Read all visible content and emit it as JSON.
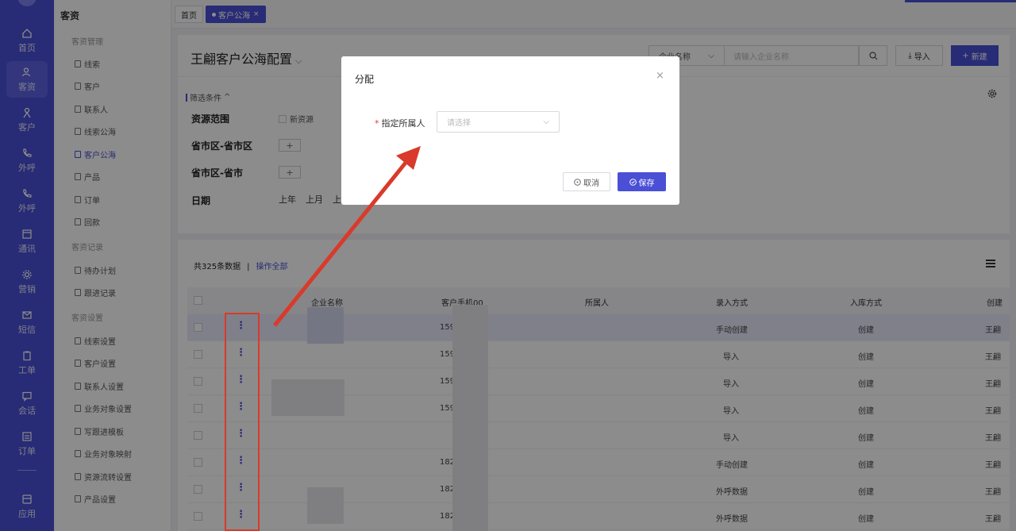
{
  "rail": {
    "items": [
      {
        "label": "首页",
        "icon": "home-icon"
      },
      {
        "label": "客资",
        "icon": "users-icon"
      },
      {
        "label": "客户",
        "icon": "person-icon"
      },
      {
        "label": "外呼",
        "icon": "phone-out-icon"
      },
      {
        "label": "外呼",
        "icon": "phone-call-icon"
      },
      {
        "label": "通讯",
        "icon": "contacts-icon"
      },
      {
        "label": "营销",
        "icon": "gear-icon"
      },
      {
        "label": "短信",
        "icon": "message-icon"
      },
      {
        "label": "工单",
        "icon": "clipboard-icon"
      },
      {
        "label": "会话",
        "icon": "chat-icon"
      },
      {
        "label": "订单",
        "icon": "order-icon"
      },
      {
        "label": "应用",
        "icon": "apps-icon"
      }
    ]
  },
  "menu": {
    "title": "客资",
    "groups": [
      {
        "label": "客资管理",
        "items": [
          "线索",
          "客户",
          "联系人",
          "线索公海",
          "客户公海",
          "产品",
          "订单",
          "回款"
        ]
      },
      {
        "label": "客资记录",
        "items": [
          "待办计划",
          "跟进记录"
        ]
      },
      {
        "label": "客资设置",
        "items": [
          "线索设置",
          "客户设置",
          "联系人设置",
          "业务对象设置",
          "写跟进模板",
          "业务对象映射",
          "资源流转设置",
          "产品设置"
        ]
      }
    ]
  },
  "tabs": [
    {
      "label": "首页"
    },
    {
      "label": "客户公海",
      "close": "×"
    }
  ],
  "header": {
    "title": "王翩客户公海配置",
    "company_select": "企业名称",
    "search_placeholder": "请输入企业名称",
    "import_label": "导入",
    "new_label": "新建"
  },
  "filters": {
    "toggle_label": "筛选条件",
    "resource_range": "资源范围",
    "new_resource": "新资源",
    "province_city_district": "省市区-省市区",
    "province_city": "省市区-省市",
    "plus": "+",
    "date": "日期",
    "date_options": [
      "上年",
      "上月",
      "上"
    ]
  },
  "table": {
    "total": "共325条数据",
    "separator": "|",
    "operate_all": "操作全部",
    "columns": [
      "企业名称",
      "客户手机00",
      "所属人",
      "录入方式",
      "入库方式",
      "创建"
    ],
    "rows": [
      {
        "phone": "159",
        "entry": "手动创建",
        "storage": "创建",
        "creator": "王翩"
      },
      {
        "phone": "159",
        "entry": "导入",
        "storage": "创建",
        "creator": "王翩"
      },
      {
        "phone": "159",
        "entry": "导入",
        "storage": "创建",
        "creator": "王翩"
      },
      {
        "phone": "159",
        "entry": "导入",
        "storage": "创建",
        "creator": "王翩"
      },
      {
        "phone": "",
        "entry": "导入",
        "storage": "创建",
        "creator": "王翩"
      },
      {
        "phone": "182",
        "entry": "手动创建",
        "storage": "创建",
        "creator": "王翩"
      },
      {
        "phone": "182",
        "entry": "外呼数据",
        "storage": "创建",
        "creator": "王翩"
      },
      {
        "phone": "182",
        "entry": "外呼数据",
        "storage": "创建",
        "creator": "王翩"
      }
    ]
  },
  "modal": {
    "title": "分配",
    "close": "×",
    "required_mark": "*",
    "owner_label": "指定所属人",
    "owner_placeholder": "请选择",
    "cancel_label": "取消",
    "save_label": "保存"
  },
  "colors": {
    "accent": "#4a4fd6",
    "annotation": "#d93a2b"
  }
}
